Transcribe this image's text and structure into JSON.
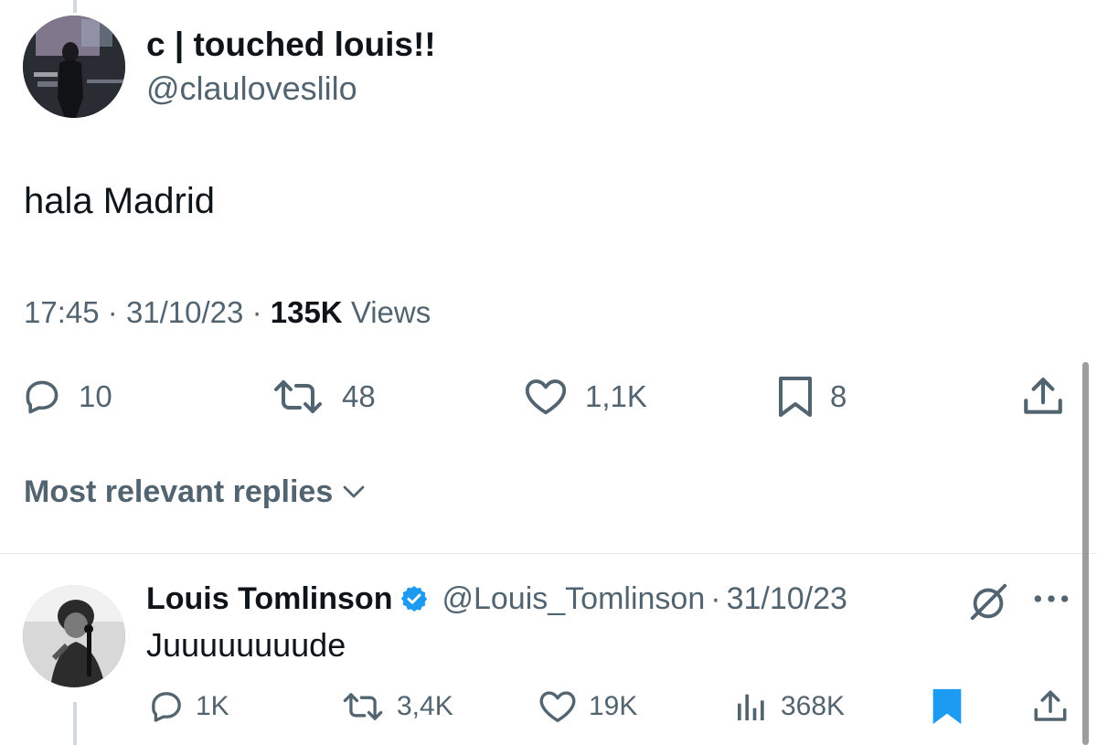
{
  "main_tweet": {
    "author": {
      "display_name": "c | touched louis!!",
      "handle": "@clauloveslilo"
    },
    "text": "hala Madrid",
    "time": "17:45",
    "date": "31/10/23",
    "separator": "·",
    "views_count": "135K",
    "views_label": "Views",
    "actions": {
      "replies": "10",
      "reposts": "48",
      "likes": "1,1K",
      "bookmarks": "8"
    }
  },
  "replies_sort": {
    "label": "Most relevant replies"
  },
  "reply": {
    "display_name": "Louis Tomlinson",
    "handle": "@Louis_Tomlinson",
    "separator": "·",
    "date": "31/10/23",
    "text": "Juuuuuuuude",
    "actions": {
      "replies": "1K",
      "reposts": "3,4K",
      "likes": "19K",
      "views": "368K"
    }
  },
  "colors": {
    "text_primary": "#0f1419",
    "text_secondary": "#536471",
    "accent_blue": "#1d9bf0",
    "divider": "#e6ebee"
  },
  "icons": [
    "reply-icon",
    "repost-icon",
    "like-icon",
    "bookmark-icon",
    "share-icon",
    "chevron-down-icon",
    "verified-badge-icon",
    "grok-icon",
    "more-icon",
    "views-icon"
  ]
}
